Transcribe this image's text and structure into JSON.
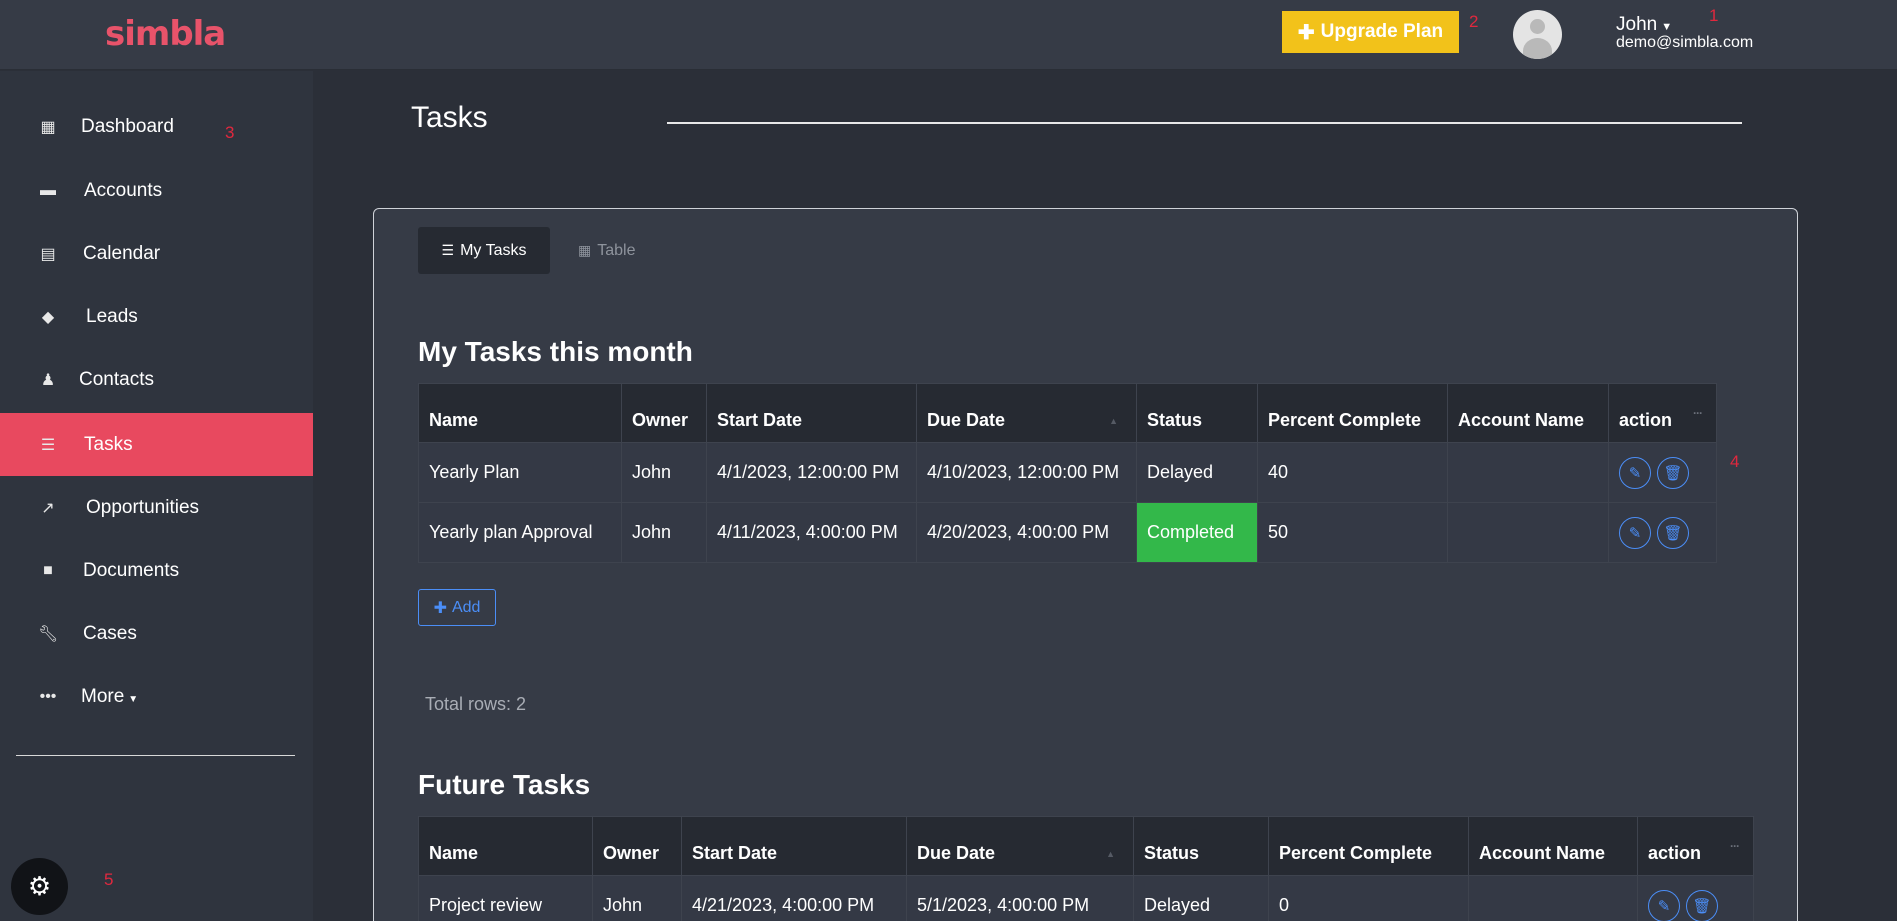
{
  "header": {
    "logo": "simbla",
    "upgrade_label": "Upgrade Plan",
    "user_name": "John",
    "user_email": "demo@simbla.com",
    "markers": [
      "1",
      "2",
      "3",
      "4",
      "5"
    ]
  },
  "sidebar": {
    "items": [
      {
        "label": "Dashboard",
        "icon": "qr-icon"
      },
      {
        "label": "Accounts",
        "icon": "briefcase-icon"
      },
      {
        "label": "Calendar",
        "icon": "calendar-icon"
      },
      {
        "label": "Leads",
        "icon": "tags-icon"
      },
      {
        "label": "Contacts",
        "icon": "person-icon"
      },
      {
        "label": "Tasks",
        "icon": "tasks-icon"
      },
      {
        "label": "Opportunities",
        "icon": "chart-icon"
      },
      {
        "label": "Documents",
        "icon": "folder-icon"
      },
      {
        "label": "Cases",
        "icon": "wrench-icon"
      },
      {
        "label": "More",
        "icon": "dots-icon"
      }
    ],
    "active": "Tasks"
  },
  "page": {
    "title": "Tasks"
  },
  "tabs": [
    {
      "label": "My Tasks"
    },
    {
      "label": "Table"
    }
  ],
  "columns": [
    "Name",
    "Owner",
    "Start Date",
    "Due Date",
    "Status",
    "Percent Complete",
    "Account Name",
    "action"
  ],
  "my_tasks": {
    "title": "My Tasks this month",
    "rows": [
      {
        "name": "Yearly Plan",
        "owner": "John",
        "start": "4/1/2023, 12:00:00 PM",
        "due": "4/10/2023, 12:00:00 PM",
        "status": "Delayed",
        "percent": "40",
        "account": ""
      },
      {
        "name": "Yearly plan Approval",
        "owner": "John",
        "start": "4/11/2023, 4:00:00 PM",
        "due": "4/20/2023, 4:00:00 PM",
        "status": "Completed",
        "percent": "50",
        "account": ""
      }
    ],
    "add_label": "Add",
    "total_rows": "Total rows: 2"
  },
  "future_tasks": {
    "title": "Future Tasks",
    "rows": [
      {
        "name": "Project review",
        "owner": "John",
        "start": "4/21/2023, 4:00:00 PM",
        "due": "5/1/2023, 4:00:00 PM",
        "status": "Delayed",
        "percent": "0",
        "account": ""
      }
    ]
  },
  "colors": {
    "accent": "#e8495f",
    "upgrade": "#f2c21a",
    "completed": "#33b84a",
    "action": "#4b8ef7"
  }
}
